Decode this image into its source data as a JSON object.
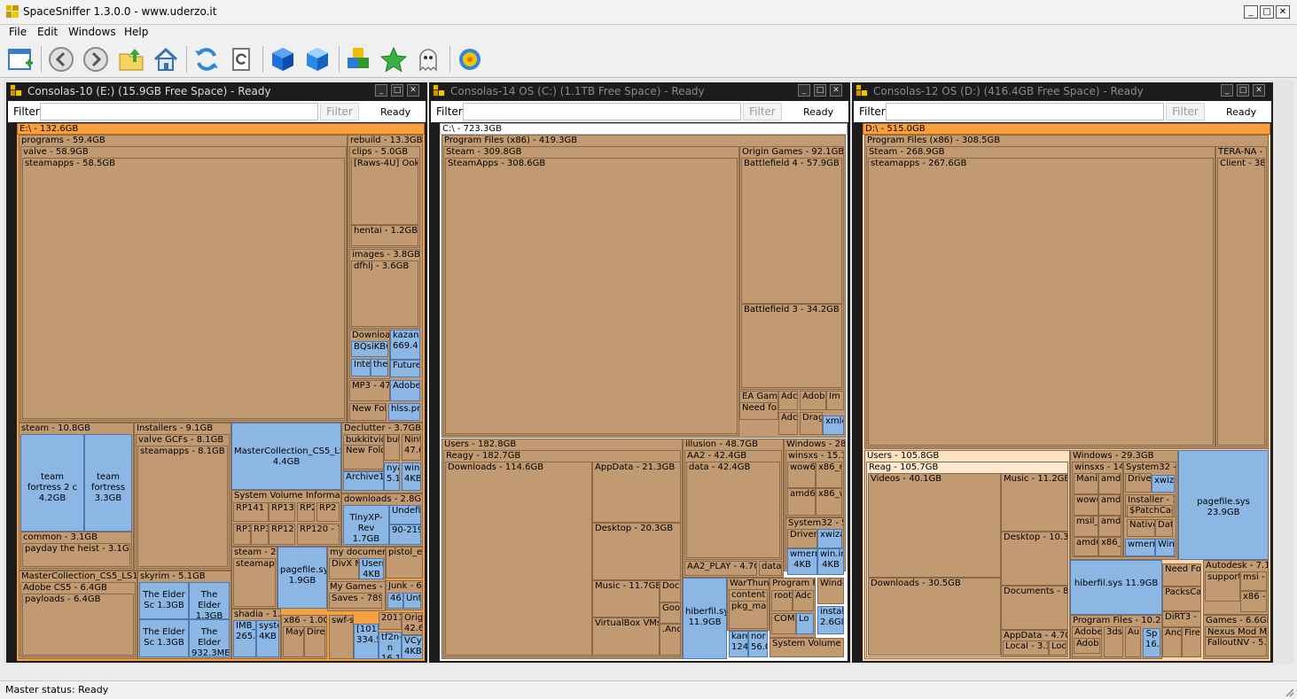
{
  "app": {
    "title": "SpaceSniffer 1.3.0.0 - www.uderzo.it"
  },
  "menu": [
    "File",
    "Edit",
    "Windows",
    "Help"
  ],
  "toolbar_icons": [
    "new-window-icon",
    "back-icon",
    "forward-icon",
    "up-folder-icon",
    "home-icon",
    "refresh-icon",
    "refresh-document-icon",
    "cube-icon",
    "cube-outline-icon",
    "blocks-icon",
    "star-icon",
    "ghost-icon",
    "gear-icon"
  ],
  "panes": [
    {
      "title": "Consolas-10 (E:) (15.9GB Free Space) - Ready",
      "filter_label": "Filter",
      "filter_button": "Filter",
      "status": "Ready",
      "root": "E:\\ - 132.6GB"
    },
    {
      "title": "Consolas-14 OS (C:) (1.1TB Free Space) - Ready",
      "filter_label": "Filter",
      "filter_button": "Filter",
      "status": "Ready",
      "root": "C:\\ - 723.3GB"
    },
    {
      "title": "Consolas-12 OS (D:) (416.4GB Free Space) - Ready",
      "filter_label": "Filter",
      "filter_button": "Filter",
      "status": "Ready",
      "root": "D:\\ - 515.0GB"
    }
  ],
  "tiles": [
    [
      "E:\\ - 132.6GB",
      "programs - 59.4GB",
      "valve - 58.9GB",
      "steamapps - 58.5GB",
      "rebuild - 13.3GB",
      "clips - 5.0GB",
      "[Raws-4U] Ookar",
      "hentai - 1.2GB",
      "images - 3.8GB",
      "dfhlj - 3.6GB",
      "Downloads",
      "BQsiKBw",
      "kazan 669.4",
      "Inter",
      "the_",
      "Future",
      "MP3 - 47",
      "Adobe",
      "New Fol",
      "hlss.png",
      "steam - 10.8GB",
      "team fortress 2 c 4.2GB",
      "team fortress 3.3GB",
      "common - 3.1GB",
      "payday the heist - 3.1GB",
      "Installers - 9.1GB",
      "valve GCFs - 8.1GB",
      "steamapps - 8.1GB",
      "MasterCollection_CS5_LS1.7 4.4GB",
      "Declutter - 3.7GB",
      "bukkitvideo",
      "New Fold",
      "buk",
      "Nint 47.6",
      "Archive1.",
      "nya 5.1",
      "win 4KB",
      "System Volume Information",
      "RP141 -",
      "RP132",
      "RP2",
      "RP2",
      "RP1",
      "RP1",
      "RP127",
      "RP120 - 7",
      "downloads - 2.8GB",
      "TinyXP-Rev 1.7GB",
      "Undefin",
      "90-219-",
      "MasterCollection_CS5_LS1 - 6.4",
      "Adobe CS5 - 6.4GB",
      "payloads - 6.4GB",
      "skyrim - 5.1GB",
      "The Elder Sc 1.3GB",
      "The Elder 1.3GB",
      "The Elder Sc 1.3GB",
      "The Elder 932.3MB",
      "steam - 2.0",
      "steamapps",
      "pagefile.sys 1.9GB",
      "my documents",
      "DivX M",
      "Usern 4KB",
      "pistol_e",
      "My Games - 1.",
      "Junk - 69",
      "Saves - 789.",
      "463",
      "Unt",
      "shadia - 1.3G",
      "IMB_ 265.8",
      "syste 4KB",
      "x86 - 1.0GE",
      "Maya",
      "Dire",
      "swf-s",
      "[1012 334.5",
      "2011",
      "tf2n-n 16.1N",
      "Orig 42.6",
      "VCyc 4KB"
    ],
    [
      "C:\\ - 723.3GB",
      "Program Files (x86) - 419.3GB",
      "Steam - 309.8GB",
      "SteamApps - 308.6GB",
      "Origin Games - 92.1GB",
      "Battlefield 4 - 57.9GB",
      "Battlefield 3 - 34.2GB",
      "EA Game",
      "Need for",
      "Adc",
      "Adobe",
      "Im",
      "Adc",
      "Drag",
      "xmle",
      "Users - 182.8GB",
      "Reagy - 182.7GB",
      "Downloads - 114.6GB",
      "AppData - 21.3GB",
      "Desktop - 20.3GB",
      "Music - 11.7GB",
      "Docu",
      "Goo",
      ".And",
      "VirtualBox VMs -",
      "illusion - 48.7GB",
      "AA2 - 42.4GB",
      "data - 42.4GB",
      "AA2_PLAY - 4.7G",
      "data",
      "hiberfil.sys 11.9GB",
      "WarThunde",
      "content - (",
      "pkg_main",
      "kare 124",
      "nor 56.0",
      "Program Fil",
      "root",
      "Adc",
      "COM",
      "Lo",
      "Windows - 28.3",
      "winsxs - 15.1G",
      "wow6",
      "x86_m",
      "amd64",
      "x86_w",
      "System32 - 5.",
      "DriverS",
      "xwiza",
      "wmerr 4KB",
      "win.in 4KB",
      "Windo",
      "instal 2.6GI",
      "System Volume Inf"
    ],
    [
      "D:\\ - 515.0GB",
      "Program Files (x86) - 308.5GB",
      "Steam - 268.9GB",
      "steamapps - 267.6GB",
      "TERA-NA - 3",
      "Client - 38.8",
      "Users - 105.8GB",
      "Reag - 105.7GB",
      "Videos - 40.1GB",
      "Downloads - 30.5GB",
      "Music - 11.2GB",
      "Desktop - 10.3GB",
      "Documents - 8.2G",
      "AppData - 4.7GB",
      "Local - 3.3G",
      "Loca",
      "Windows - 29.3GB",
      "winsxs - 14.8G",
      "System32 - 4",
      "Manif",
      "amd64",
      "Driver",
      "xwiza",
      "wow6",
      "amd64",
      "Installer - 3.9",
      "$PatchCach",
      "msil_",
      "amd64",
      "Native",
      "Dat",
      "amd64",
      "x86_w",
      "wmerr",
      "Winc",
      "pagefile.sys 23.9GB",
      "hiberfil.sys 11.9GB",
      "Program Files - 10.2GB",
      "Adobe -",
      "Adobe",
      "3ds",
      "Au",
      "Sp 16.",
      "Need Fo",
      "PacksCa",
      "DiRT3 -",
      "Anc",
      "Fire",
      "Autodesk - 7.1G",
      "support",
      "msi -",
      "x86 -",
      "Games - 6.6GB",
      "Nexus Mod Ma",
      "FalloutNV - 5."
    ]
  ],
  "statusbar": {
    "text": "Master status: Ready"
  }
}
